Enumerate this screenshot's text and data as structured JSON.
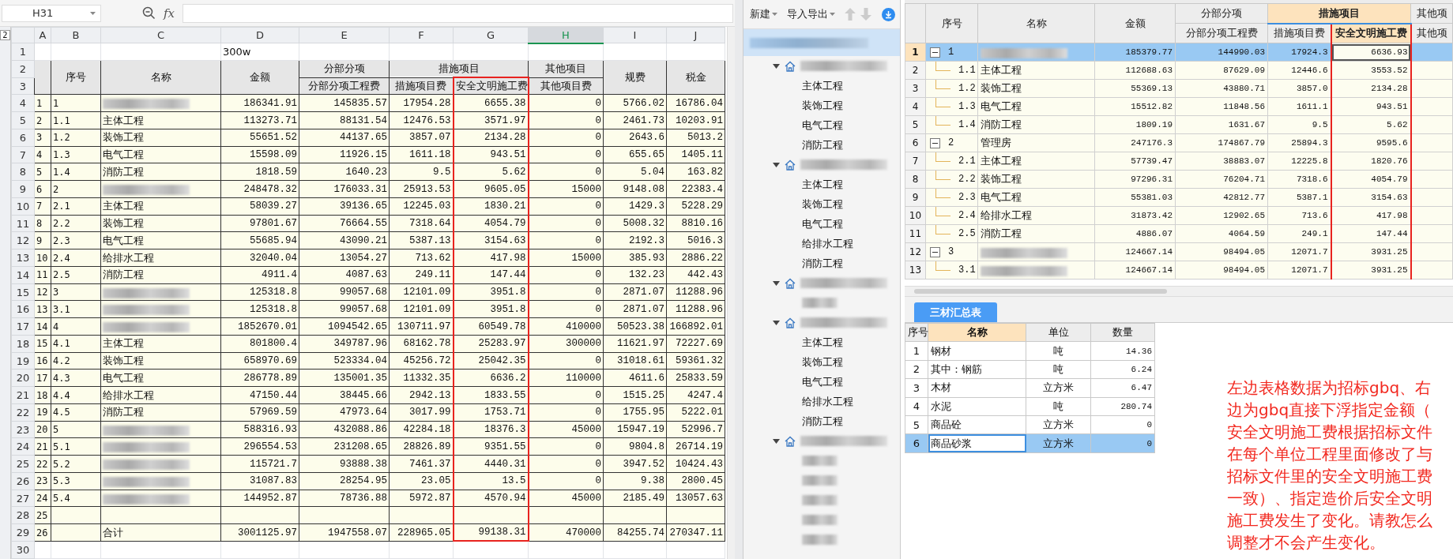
{
  "spreadsheet": {
    "name_box": "H31",
    "formula_prefix": "fx",
    "outline_level": "2",
    "columns": [
      {
        "letter": "A",
        "selected": false
      },
      {
        "letter": "B",
        "selected": false
      },
      {
        "letter": "C",
        "selected": false
      },
      {
        "letter": "D",
        "selected": false
      },
      {
        "letter": "E",
        "selected": false
      },
      {
        "letter": "F",
        "selected": false
      },
      {
        "letter": "G",
        "selected": false
      },
      {
        "letter": "H",
        "selected": true
      },
      {
        "letter": "I",
        "selected": false
      },
      {
        "letter": "J",
        "selected": false
      }
    ],
    "title_row": {
      "row": "1",
      "text": "300w"
    },
    "header_rows": [
      "2",
      "3"
    ],
    "header": [
      {
        "label": "序号"
      },
      {
        "label": "名称"
      },
      {
        "label": "金额"
      },
      {
        "label": "分部分项",
        "children": [
          {
            "label": "分部分项工程费",
            "framed": false
          }
        ]
      },
      {
        "label": "措施项目",
        "children": [
          {
            "label": "措施项目费",
            "framed": false
          },
          {
            "label": "安全文明施工费",
            "framed": true
          }
        ]
      },
      {
        "label": "其他项目",
        "children": [
          {
            "label": "其他项目费",
            "framed": false
          }
        ]
      },
      {
        "label": "规费"
      },
      {
        "label": "税金"
      }
    ],
    "rows": [
      {
        "row": "4",
        "index": "1",
        "code": "1",
        "redacted": true,
        "values": [
          "186341.91",
          "145835.57",
          "17954.28",
          "6655.38",
          "0",
          "5766.02",
          "16786.04"
        ]
      },
      {
        "row": "5",
        "index": "2",
        "code": "1.1",
        "name": "主体工程",
        "values": [
          "113273.71",
          "88131.54",
          "12476.53",
          "3571.97",
          "0",
          "2461.73",
          "10203.91"
        ]
      },
      {
        "row": "6",
        "index": "3",
        "code": "1.2",
        "name": "装饰工程",
        "values": [
          "55651.52",
          "44137.65",
          "3857.07",
          "2134.28",
          "0",
          "2643.6",
          "5013.2"
        ]
      },
      {
        "row": "7",
        "index": "4",
        "code": "1.3",
        "name": "电气工程",
        "values": [
          "15598.09",
          "11926.15",
          "1611.18",
          "943.51",
          "0",
          "655.65",
          "1405.11"
        ]
      },
      {
        "row": "8",
        "index": "5",
        "code": "1.4",
        "name": "消防工程",
        "values": [
          "1818.59",
          "1640.23",
          "9.5",
          "5.62",
          "0",
          "5.04",
          "163.82"
        ]
      },
      {
        "row": "9",
        "index": "6",
        "code": "2",
        "redacted": true,
        "values": [
          "248478.32",
          "176033.31",
          "25913.53",
          "9605.05",
          "15000",
          "9148.08",
          "22383.4"
        ]
      },
      {
        "row": "10",
        "index": "7",
        "code": "2.1",
        "name": "主体工程",
        "values": [
          "58039.27",
          "39136.65",
          "12245.03",
          "1830.21",
          "0",
          "1429.3",
          "5228.29"
        ]
      },
      {
        "row": "11",
        "index": "8",
        "code": "2.2",
        "name": "装饰工程",
        "values": [
          "97801.67",
          "76664.55",
          "7318.64",
          "4054.79",
          "0",
          "5008.32",
          "8810.16"
        ]
      },
      {
        "row": "12",
        "index": "9",
        "code": "2.3",
        "name": "电气工程",
        "values": [
          "55685.94",
          "43090.21",
          "5387.13",
          "3154.63",
          "0",
          "2192.3",
          "5016.3"
        ]
      },
      {
        "row": "13",
        "index": "10",
        "code": "2.4",
        "name": "给排水工程",
        "values": [
          "32040.04",
          "13054.27",
          "713.62",
          "417.98",
          "15000",
          "385.93",
          "2886.22"
        ]
      },
      {
        "row": "14",
        "index": "11",
        "code": "2.5",
        "name": "消防工程",
        "values": [
          "4911.4",
          "4087.63",
          "249.11",
          "147.44",
          "0",
          "132.23",
          "442.43"
        ]
      },
      {
        "row": "15",
        "index": "12",
        "code": "3",
        "redacted": true,
        "values": [
          "125318.8",
          "99057.68",
          "12101.09",
          "3951.8",
          "0",
          "2871.07",
          "11288.96"
        ]
      },
      {
        "row": "16",
        "index": "13",
        "code": "3.1",
        "redacted": true,
        "values": [
          "125318.8",
          "99057.68",
          "12101.09",
          "3951.8",
          "0",
          "2871.07",
          "11288.96"
        ]
      },
      {
        "row": "17",
        "index": "14",
        "code": "4",
        "redacted": true,
        "values": [
          "1852670.01",
          "1094542.65",
          "130711.97",
          "60549.78",
          "410000",
          "50523.38",
          "166892.01"
        ]
      },
      {
        "row": "18",
        "index": "15",
        "code": "4.1",
        "name": "主体工程",
        "values": [
          "801800.4",
          "349787.96",
          "68162.78",
          "25283.97",
          "300000",
          "11621.97",
          "72227.69"
        ]
      },
      {
        "row": "19",
        "index": "16",
        "code": "4.2",
        "name": "装饰工程",
        "values": [
          "658970.69",
          "523334.04",
          "45256.72",
          "25042.35",
          "0",
          "31018.61",
          "59361.32"
        ]
      },
      {
        "row": "20",
        "index": "17",
        "code": "4.3",
        "name": "电气工程",
        "values": [
          "286778.89",
          "135001.35",
          "11332.35",
          "6636.2",
          "110000",
          "4611.6",
          "25833.59"
        ]
      },
      {
        "row": "21",
        "index": "18",
        "code": "4.4",
        "name": "给排水工程",
        "values": [
          "47150.44",
          "38445.66",
          "2942.13",
          "1833.55",
          "0",
          "1515.25",
          "4247.4"
        ]
      },
      {
        "row": "22",
        "index": "19",
        "code": "4.5",
        "name": "消防工程",
        "values": [
          "57969.59",
          "47973.64",
          "3017.99",
          "1753.71",
          "0",
          "1755.95",
          "5222.01"
        ]
      },
      {
        "row": "23",
        "index": "20",
        "code": "5",
        "redacted": true,
        "values": [
          "588316.93",
          "432088.86",
          "42284.18",
          "18376.3",
          "45000",
          "15947.19",
          "52996.7"
        ]
      },
      {
        "row": "24",
        "index": "21",
        "code": "5.1",
        "redacted": true,
        "values": [
          "296554.53",
          "231208.65",
          "28826.89",
          "9351.55",
          "0",
          "9804.8",
          "26714.19"
        ]
      },
      {
        "row": "25",
        "index": "22",
        "code": "5.2",
        "redacted": true,
        "values": [
          "115721.7",
          "93888.38",
          "7461.37",
          "4440.31",
          "0",
          "3947.52",
          "10424.43"
        ]
      },
      {
        "row": "26",
        "index": "23",
        "code": "5.3",
        "redacted": true,
        "values": [
          "31087.83",
          "28254.95",
          "23.05",
          "13.5",
          "0",
          "9.38",
          "2800.45"
        ]
      },
      {
        "row": "27",
        "index": "24",
        "code": "5.4",
        "redacted": true,
        "values": [
          "144952.87",
          "78736.88",
          "5972.87",
          "4570.94",
          "45000",
          "2185.49",
          "13057.63"
        ]
      },
      {
        "row": "28",
        "index": "25"
      },
      {
        "row": "29",
        "index": "26",
        "name": "合计",
        "values": [
          "3001125.97",
          "1947558.07",
          "228965.05",
          "99138.31",
          "470000",
          "84255.74",
          "270347.11"
        ]
      }
    ],
    "trailing_rows": [
      "30"
    ]
  },
  "tree": {
    "toolbar": [
      {
        "label": "新建"
      },
      {
        "label": "导入导出"
      }
    ],
    "root": {
      "selected": true,
      "redacted": true,
      "children": [
        {
          "redacted": true,
          "expanded": true,
          "children": [
            {
              "label": "主体工程"
            },
            {
              "label": "装饰工程"
            },
            {
              "label": "电气工程"
            },
            {
              "label": "消防工程"
            }
          ]
        },
        {
          "redacted": true,
          "expanded": true,
          "children": [
            {
              "label": "主体工程"
            },
            {
              "label": "装饰工程"
            },
            {
              "label": "电气工程"
            },
            {
              "label": "给排水工程"
            },
            {
              "label": "消防工程"
            }
          ]
        },
        {
          "redacted": true,
          "expanded": true,
          "children": [
            {
              "redacted": true
            }
          ]
        },
        {
          "redacted": true,
          "expanded": true,
          "children": [
            {
              "label": "主体工程"
            },
            {
              "label": "装饰工程"
            },
            {
              "label": "电气工程"
            },
            {
              "label": "给排水工程"
            },
            {
              "label": "消防工程"
            }
          ]
        },
        {
          "redacted": true,
          "expanded": true,
          "children": [
            {
              "redacted": true
            },
            {
              "redacted": true
            },
            {
              "redacted": true
            },
            {
              "redacted": true
            },
            {
              "redacted": true
            }
          ]
        }
      ]
    }
  },
  "grid": {
    "header": [
      {
        "label": "序号"
      },
      {
        "label": "名称"
      },
      {
        "label": "金额"
      },
      {
        "label": "分部分项",
        "selected": false,
        "children": [
          {
            "label": "分部分项工程费",
            "selected": false,
            "framed": false
          }
        ]
      },
      {
        "label": "措施项目",
        "selected": true,
        "children": [
          {
            "label": "措施项目费",
            "selected": false,
            "framed": false
          },
          {
            "label": "安全文明施工费",
            "selected": true,
            "framed": true
          }
        ]
      },
      {
        "label": "其他项",
        "selected": false,
        "children": [
          {
            "label": "其他项",
            "selected": false,
            "framed": false
          }
        ]
      }
    ],
    "rows": [
      {
        "row": "1",
        "code": "1",
        "redacted": true,
        "expanded": true,
        "selected": true,
        "values": [
          "185379.77",
          "144990.03",
          "17924.3",
          "6636.93"
        ],
        "children": [
          {
            "row": "2",
            "code": "1.1",
            "name": "主体工程",
            "selected": false,
            "values": [
              "112688.63",
              "87629.09",
              "12446.6",
              "3553.52"
            ]
          },
          {
            "row": "3",
            "code": "1.2",
            "name": "装饰工程",
            "selected": false,
            "values": [
              "55369.13",
              "43880.71",
              "3857.0",
              "2134.28"
            ]
          },
          {
            "row": "4",
            "code": "1.3",
            "name": "电气工程",
            "selected": false,
            "values": [
              "15512.82",
              "11848.56",
              "1611.1",
              "943.51"
            ]
          },
          {
            "row": "5",
            "code": "1.4",
            "name": "消防工程",
            "selected": false,
            "values": [
              "1809.19",
              "1631.67",
              "9.5",
              "5.62"
            ]
          }
        ]
      },
      {
        "row": "6",
        "code": "2",
        "name": "管理房",
        "expanded": true,
        "selected": false,
        "values": [
          "247176.3",
          "174867.79",
          "25894.3",
          "9595.6"
        ],
        "children": [
          {
            "row": "7",
            "code": "2.1",
            "name": "主体工程",
            "selected": false,
            "values": [
              "57739.47",
              "38883.07",
              "12225.8",
              "1820.76"
            ]
          },
          {
            "row": "8",
            "code": "2.2",
            "name": "装饰工程",
            "selected": false,
            "values": [
              "97296.31",
              "76204.71",
              "7318.6",
              "4054.79"
            ]
          },
          {
            "row": "9",
            "code": "2.3",
            "name": "电气工程",
            "selected": false,
            "values": [
              "55381.03",
              "42812.77",
              "5387.1",
              "3154.63"
            ]
          },
          {
            "row": "10",
            "code": "2.4",
            "name": "给排水工程",
            "selected": false,
            "values": [
              "31873.42",
              "12902.65",
              "713.6",
              "417.98"
            ]
          },
          {
            "row": "11",
            "code": "2.5",
            "name": "消防工程",
            "selected": false,
            "values": [
              "4886.07",
              "4064.59",
              "249.1",
              "147.44"
            ]
          }
        ]
      },
      {
        "row": "12",
        "code": "3",
        "redacted": true,
        "expanded": true,
        "selected": false,
        "values": [
          "124667.14",
          "98494.05",
          "12071.7",
          "3931.25"
        ],
        "children": [
          {
            "row": "13",
            "code": "3.1",
            "redacted": true,
            "selected": false,
            "values": [
              "124667.14",
              "98494.05",
              "12071.7",
              "3931.25"
            ]
          }
        ]
      }
    ]
  },
  "materials": {
    "tab": {
      "label": "三材汇总表",
      "selected": true
    },
    "columns": [
      {
        "label": "序号",
        "selected": false
      },
      {
        "label": "名称",
        "selected": true
      },
      {
        "label": "单位",
        "selected": false
      },
      {
        "label": "数量",
        "selected": false
      }
    ],
    "rows": [
      {
        "index": "1",
        "name": "钢材",
        "unit": "吨",
        "quantity": "14.36",
        "selected": false
      },
      {
        "index": "2",
        "name": "其中：钢筋",
        "unit": "吨",
        "quantity": "6.24",
        "selected": false
      },
      {
        "index": "3",
        "name": "木材",
        "unit": "立方米",
        "quantity": "6.47",
        "selected": false
      },
      {
        "index": "4",
        "name": "水泥",
        "unit": "吨",
        "quantity": "280.74",
        "selected": false
      },
      {
        "index": "5",
        "name": "商品砼",
        "unit": "立方米",
        "quantity": "0",
        "selected": false
      },
      {
        "index": "6",
        "name": "商品砂浆",
        "unit": "立方米",
        "quantity": "0",
        "selected": true
      }
    ]
  },
  "note": "左边表格数据为招标gbq、右边为gbq直接下浮指定金额（安全文明施工费根据招标文件在每个单位工程里面修改了与招标文件里的安全文明施工费一致）、指定造价后安全文明施工费发生了变化。请教怎么调整才不会产生变化。"
}
